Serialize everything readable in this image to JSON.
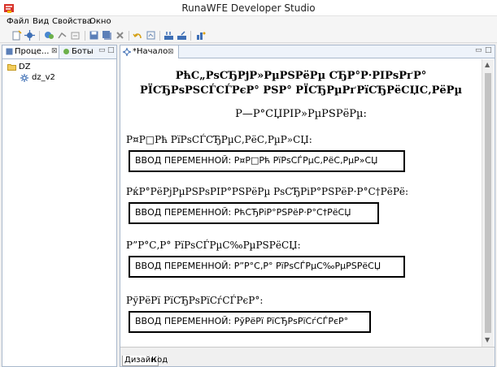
{
  "window": {
    "title": "RunaWFE Developer Studio"
  },
  "menu": {
    "items": [
      "Файл",
      "Вид",
      "Свойства",
      "Окно"
    ]
  },
  "left_panel": {
    "tabs": [
      {
        "label": "Проце..."
      },
      {
        "label": "Боты"
      }
    ],
    "tree": [
      {
        "label": "DZ"
      },
      {
        "label": "dz_v2"
      }
    ]
  },
  "editor": {
    "tab_label": "*Начало",
    "bottom_tabs": [
      "Дизайн",
      "Код"
    ]
  },
  "form": {
    "title_line1": "РћС„РѕСЂРјР»РµРЅРёРµ СЂР°Р·РІРѕРґР°",
    "title_line2": "РЇСЂРѕРЅСЃСЃРєР° РЅР° РЇСЂРµРґРїСЂРёСЏС‚РёРµ",
    "subtitle": "Р—Р°СЏРІР»РµРЅРёРµ:",
    "fields": [
      {
        "label": "Р¤Р□Рћ РїРѕСЃСЂРµС‚РёС‚РµР»СЏ:",
        "box": "ВВОД ПЕРЕМЕННОЙ: Р¤Р□Рћ РїРѕСЃРµС‚РёС‚РµР»СЏ"
      },
      {
        "label": "РќР°РёРјРµРЅРѕРІР°РЅРёРµ РѕСЂРіР°РЅРёР·Р°С†РёРё:",
        "box": "ВВОД ПЕРЕМЕННОЙ: РћСЂРіР°РЅРёР·Р°С†РёСЏ"
      },
      {
        "label": "Р”Р°С‚Р° РїРѕСЃРµС‰РµРЅРёСЏ:",
        "box": "ВВОД ПЕРЕМЕННОЙ: Р”Р°С‚Р° РїРѕСЃРµС‰РµРЅРёСЏ"
      },
      {
        "label": "РўРёРї РїСЂРѕРїСѓСЃРєР°:",
        "box": "ВВОД ПЕРЕМЕННОЙ: РўРёРї РїСЂРѕРїСѓСЃРєР°"
      }
    ]
  },
  "colors": {
    "accent": "#1e5aa8",
    "panel_border": "#a9b8cc"
  }
}
